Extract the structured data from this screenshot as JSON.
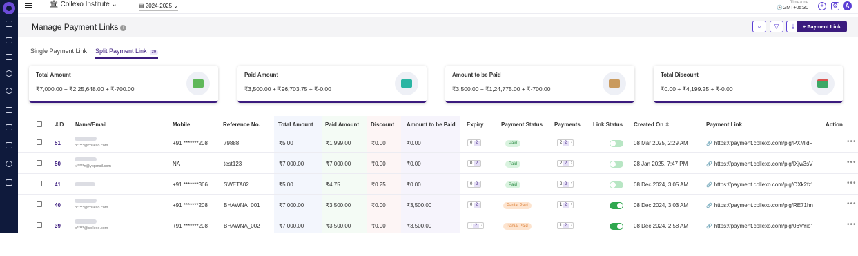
{
  "topbar": {
    "institute": "Collexo Institute",
    "academic_year": "2024-2025",
    "timezone_label": "Timezone",
    "timezone_value": "GMT+05:30",
    "avatar_initial": "A"
  },
  "header": {
    "title": "Manage Payment Links",
    "create_button": "+ Payment Link"
  },
  "tabs": [
    {
      "label": "Single Payment Link",
      "active": false
    },
    {
      "label": "Split Payment Link",
      "count": "39",
      "active": true
    }
  ],
  "cards": [
    {
      "title": "Total Amount",
      "value": "₹7,000.00 + ₹2,25,648.00 + ₹-700.00",
      "icon": "money-stack-icon"
    },
    {
      "title": "Paid Amount",
      "value": "₹3,500.00 + ₹96,703.75 + ₹-0.00",
      "icon": "wallet-icon"
    },
    {
      "title": "Amount to be Paid",
      "value": "₹3,500.00 + ₹1,24,775.00 + ₹-700.00",
      "icon": "cash-hand-icon"
    },
    {
      "title": "Total Discount",
      "value": "₹0.00 + ₹4,199.25 + ₹-0.00",
      "icon": "calendar-discount-icon"
    }
  ],
  "table": {
    "columns": [
      "#ID",
      "Name/Email",
      "Mobile",
      "Reference No.",
      "Total Amount",
      "Paid Amount",
      "Discount",
      "Amount to be Paid",
      "Expiry",
      "Payment Status",
      "Payments",
      "Link Status",
      "Created On",
      "Payment Link",
      "Action"
    ],
    "rows": [
      {
        "id": "51",
        "email": "b*****@collexo.com",
        "mobile": "+91 *******208",
        "ref": "79888",
        "total": "₹5.00",
        "paid": "₹1,999.00",
        "discount": "₹0.00",
        "due": "₹0.00",
        "expiry_a": "0",
        "expiry_b": "2",
        "status": "Paid",
        "pay_a": "2",
        "pay_b": "2",
        "link_on": false,
        "created": "08 Mar 2025, 2:29 AM",
        "link": "https://payment.collexo.com/plg/PXMldF"
      },
      {
        "id": "50",
        "email": "k*****n@yopmail.com",
        "mobile": "NA",
        "ref": "test123",
        "total": "₹7,000.00",
        "paid": "₹7,000.00",
        "discount": "₹0.00",
        "due": "₹0.00",
        "expiry_a": "0",
        "expiry_b": "2",
        "status": "Paid",
        "pay_a": "2",
        "pay_b": "2",
        "link_on": false,
        "created": "28 Jan 2025, 7:47 PM",
        "link": "https://payment.collexo.com/plg/lXjw3sV"
      },
      {
        "id": "41",
        "email": "",
        "mobile": "+91 *******366",
        "ref": "SWETA02",
        "total": "₹5.00",
        "paid": "₹4.75",
        "discount": "₹0.25",
        "due": "₹0.00",
        "expiry_a": "0",
        "expiry_b": "2",
        "status": "Paid",
        "pay_a": "2",
        "pay_b": "2",
        "link_on": false,
        "created": "08 Dec 2024, 3:05 AM",
        "link": "https://payment.collexo.com/plg/OXk2fz'"
      },
      {
        "id": "40",
        "email": "b*****@collexo.com",
        "mobile": "+91 *******208",
        "ref": "BHAWNA_001",
        "total": "₹7,000.00",
        "paid": "₹3,500.00",
        "discount": "₹0.00",
        "due": "₹3,500.00",
        "expiry_a": "0",
        "expiry_b": "2",
        "status": "Partial Paid",
        "pay_a": "1",
        "pay_b": "2",
        "link_on": true,
        "created": "08 Dec 2024, 3:03 AM",
        "link": "https://payment.collexo.com/plg/RE71hn"
      },
      {
        "id": "39",
        "email": "b*****@collexo.com",
        "mobile": "+91 *******208",
        "ref": "BHAWNA_002",
        "total": "₹7,000.00",
        "paid": "₹3,500.00",
        "discount": "₹0.00",
        "due": "₹3,500.00",
        "expiry_a": "1",
        "expiry_b": "2",
        "status": "Partial Paid",
        "pay_a": "1",
        "pay_b": "2",
        "link_on": true,
        "created": "08 Dec 2024, 2:58 AM",
        "link": "https://payment.collexo.com/plg/06VYio'"
      }
    ]
  }
}
